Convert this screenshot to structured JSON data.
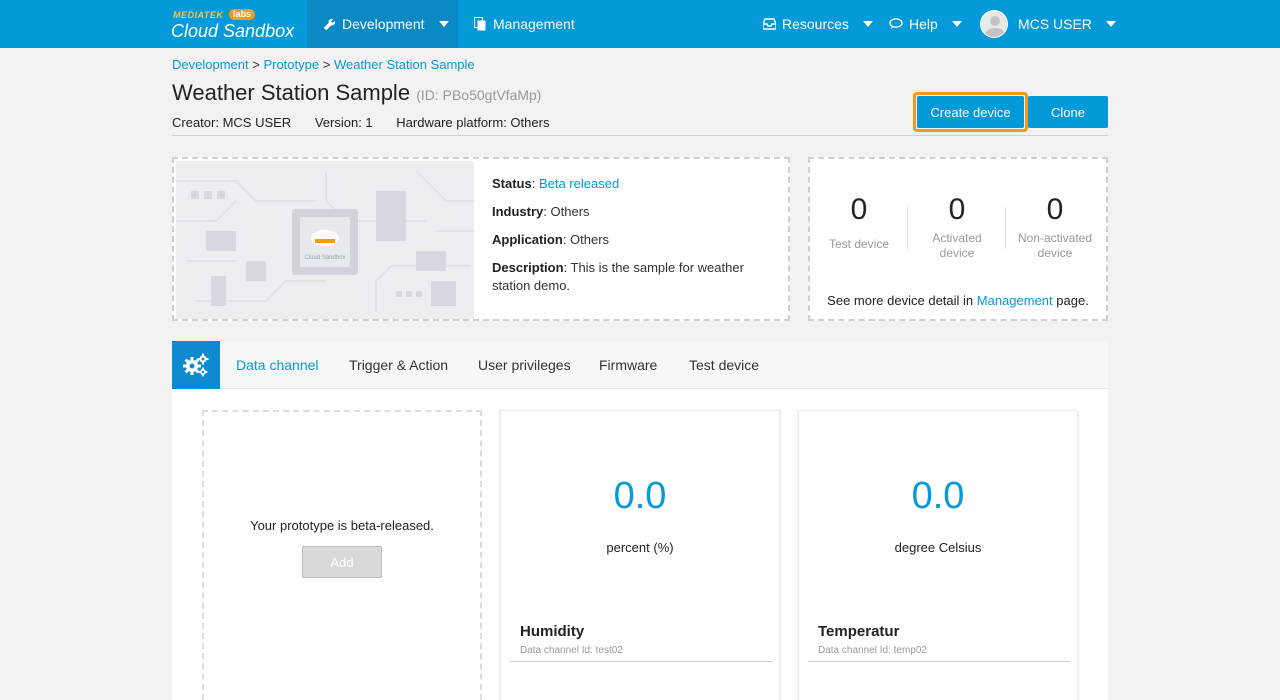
{
  "brand": {
    "top": "MEDIATEK",
    "labs": "labs",
    "name": "Cloud Sandbox"
  },
  "nav": {
    "development": "Development",
    "management": "Management",
    "resources": "Resources",
    "help": "Help",
    "user": "MCS USER"
  },
  "breadcrumb": {
    "items": [
      "Development",
      "Prototype",
      "Weather Station Sample"
    ],
    "sep": ">"
  },
  "prototype": {
    "title": "Weather Station Sample",
    "id_text": "(ID: PBo50gtVfaMp)",
    "creator": "Creator: MCS USER",
    "version": "Version: 1",
    "hardware": "Hardware platform: Others"
  },
  "actions": {
    "create_device": "Create device",
    "clone": "Clone"
  },
  "info": {
    "status_label": "Status",
    "status_value": "Beta released",
    "industry_label": "Industry",
    "industry_value": ": Others",
    "application_label": "Application",
    "application_value": ": Others",
    "description_label": "Description",
    "description_value": ": This is the sample for weather station demo.",
    "board_caption": "Cloud Sandbox"
  },
  "counts": {
    "test": {
      "value": "0",
      "label": "Test device"
    },
    "activated": {
      "value": "0",
      "label": "Activated device"
    },
    "non_activated": {
      "value": "0",
      "label": "Non-activated device"
    },
    "footer_pre": "See more device detail in ",
    "footer_link": "Management",
    "footer_post": " page."
  },
  "tabs": [
    "Data channel",
    "Trigger & Action",
    "User privileges",
    "Firmware",
    "Test device"
  ],
  "channels": {
    "add_message": "Your prototype is beta-released.",
    "add_label": "Add",
    "items": [
      {
        "value": "0.0",
        "unit": "percent (%)",
        "name": "Humidity",
        "id": "Data channel Id: test02"
      },
      {
        "value": "0.0",
        "unit": "degree Celsius",
        "name": "Temperatur",
        "id": "Data channel Id: temp02"
      }
    ]
  },
  "colors": {
    "primary": "#0499d9",
    "highlight": "#f39a1d",
    "nav_active": "#0b89c4"
  }
}
